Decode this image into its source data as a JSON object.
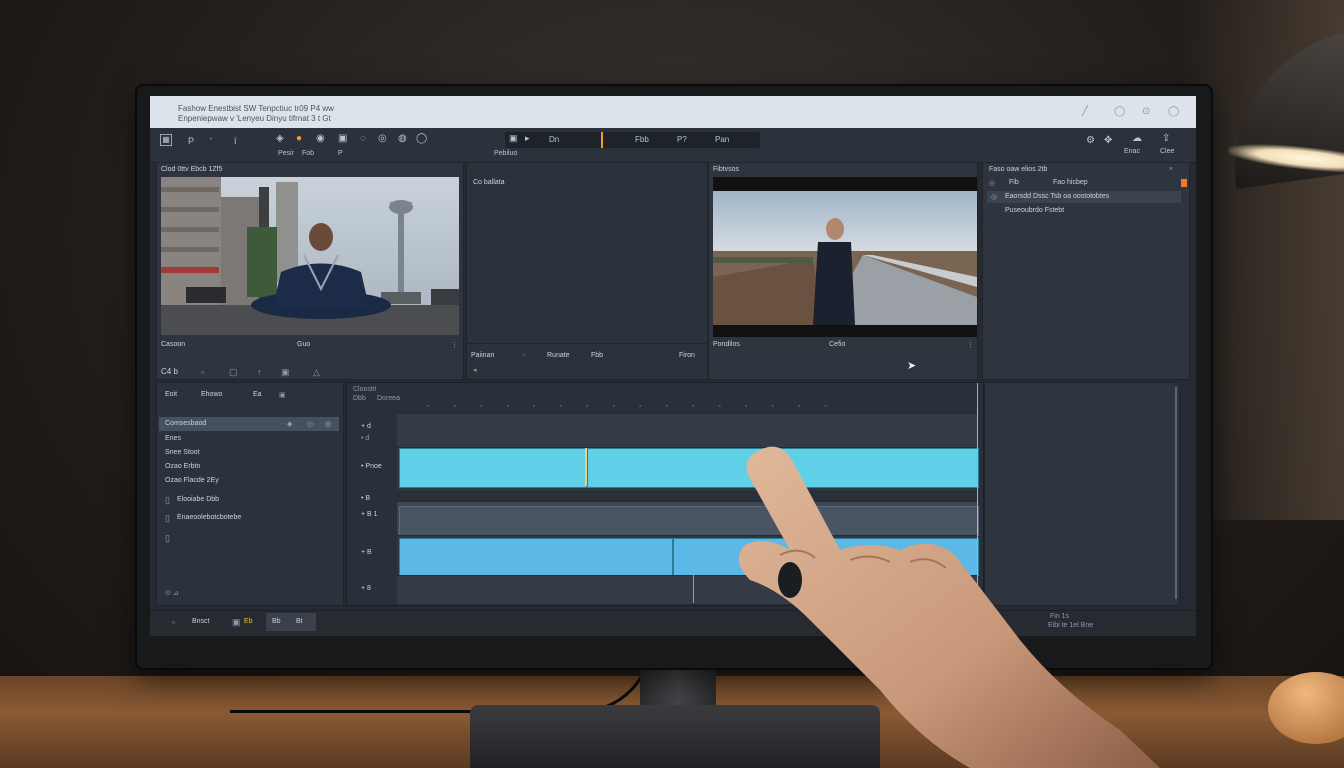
{
  "scene": {
    "colors": {
      "wall": "#2a2421",
      "desk": "#7a4e2e",
      "screen_bg": "#262b33",
      "clip_cyan": "#5fd0e8",
      "clip_blue": "#5cb8e6",
      "titlebar": "#dde3ea",
      "accent": "#f0a030"
    }
  },
  "app": {
    "title_line1": "Fashow Enestbist SW Tenpctiuc tr09    P4 ww",
    "title_line2": "Enpeniepwaw v 'Lenyeu Dinyu tifrnat 3 t    Gt",
    "toolbar": {
      "left_labels": [
        "P",
        "'",
        "ï"
      ],
      "center_labels": [
        "Pesir",
        "Fob",
        "P"
      ],
      "transport_label": "Pebiluo",
      "transport_items": [
        "Dn",
        "Fbb",
        "P?",
        "Pan"
      ],
      "right_labels": [
        "Enac",
        "Clee"
      ]
    },
    "source_monitor": {
      "header": "Clod 0ttv  Ebcb 1Zf5",
      "footer_left": "Casoon",
      "footer_mid": "Guo"
    },
    "effects_panel": {
      "header": "Co ballata",
      "footer_items": [
        "Paiinan",
        "Runate",
        "Fbb",
        "Firon"
      ]
    },
    "program_monitor": {
      "header": "Fibtvsos",
      "footer_left": "Pondilos",
      "footer_mid": "Cefio"
    },
    "project_panel": {
      "header": "Faso oaw elios 2tb",
      "row1_a": "Fib",
      "row1_b": "Fao hicbep",
      "row2": "Eaorsdd Dssc  Tsb oa oostotobtes",
      "row3": "Puseoubrdo Fstebt"
    },
    "browser_panel": {
      "top_icons": [
        "C4 b",
        "Ф",
        "Ф"
      ],
      "tabs": [
        "Eoit",
        "Ehowo",
        "Ea"
      ],
      "items": [
        "Comsesbaod",
        "Enes",
        "Snee Stoot",
        "Ozao Erbtn",
        "Ozao Flacde 2Ey"
      ],
      "bottom_items": [
        "Elooiabe Dbb",
        "Enaeoolebotcbotebe"
      ]
    },
    "timeline": {
      "header_a": "Cloostit",
      "header_b": "Dbb",
      "header_c": "Doreea",
      "track_labels": [
        "+ d",
        "• Pnoe",
        "• B",
        "+ B 1",
        "+ B",
        "+ 8"
      ]
    },
    "bottom_bar": {
      "items": [
        "Bnsct",
        "Eb",
        "Bb",
        "Bt"
      ],
      "right_status_1": "Fin 1s",
      "right_status_2": "Eibi te 1el Bne"
    }
  }
}
